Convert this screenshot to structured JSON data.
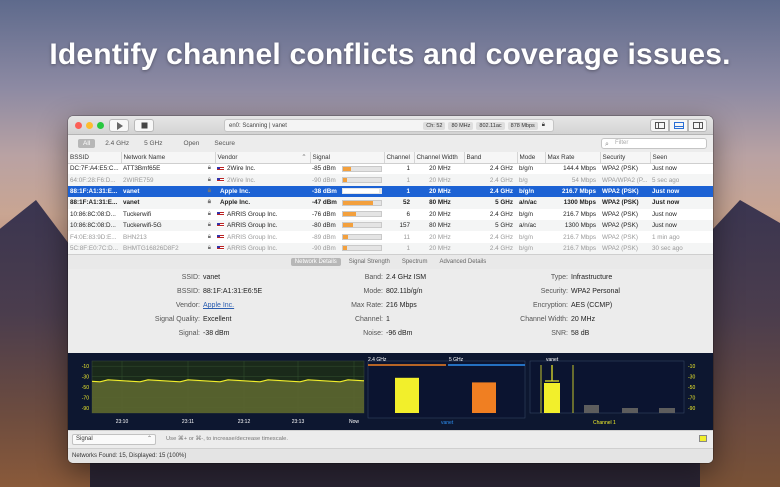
{
  "headline": "Identify channel conflicts and coverage issues.",
  "toolbar": {
    "status": "en0: Scanning  |  vanet",
    "chips": [
      "Ch: 52",
      "80 MHz",
      "802.11ac",
      "878 Mbps"
    ]
  },
  "filters": {
    "tabs": [
      "All",
      "2.4 GHz",
      "5 GHz",
      "Open",
      "Secure"
    ],
    "search_placeholder": "Filter"
  },
  "table": {
    "columns": [
      "BSSID",
      "Network Name",
      "Vendor",
      "Signal",
      "Channel",
      "Channel Width",
      "Band",
      "Mode",
      "Max Rate",
      "Security",
      "Seen"
    ],
    "rows": [
      {
        "bssid": "DC:7F:A4:E5:C...",
        "name": "ATT3Bmf65E",
        "vendor": "2Wire Inc.",
        "signal": "-85 dBm",
        "level": 0.22,
        "channel": "1",
        "width": "20 MHz",
        "band": "2.4 GHz",
        "mode": "b/g/n",
        "rate": "144.4 Mbps",
        "security": "WPA2 (PSK)",
        "seen": "Just now"
      },
      {
        "bssid": "64:0F:28:F6:D...",
        "name": "2WIRE759",
        "vendor": "2Wire Inc.",
        "signal": "-90 dBm",
        "level": 0.1,
        "channel": "1",
        "width": "20 MHz",
        "band": "2.4 GHz",
        "mode": "b/g",
        "rate": "54 Mbps",
        "security": "WPA/WPA2 (P...",
        "seen": "5 sec ago"
      },
      {
        "bssid": "88:1F:A1:31:E...",
        "name": "vanet",
        "vendor": "Apple Inc.",
        "signal": "-38 dBm",
        "level": 0.95,
        "channel": "1",
        "width": "20 MHz",
        "band": "2.4 GHz",
        "mode": "b/g/n",
        "rate": "216.7 Mbps",
        "security": "WPA2 (PSK)",
        "seen": "Just now"
      },
      {
        "bssid": "88:1F:A1:31:E...",
        "name": "vanet",
        "vendor": "Apple Inc.",
        "signal": "-47 dBm",
        "level": 0.8,
        "channel": "52",
        "width": "80 MHz",
        "band": "5 GHz",
        "mode": "a/n/ac",
        "rate": "1300 Mbps",
        "security": "WPA2 (PSK)",
        "seen": "Just now"
      },
      {
        "bssid": "10:86:8C:08:D...",
        "name": "Tuckerwifi",
        "vendor": "ARRIS Group Inc.",
        "signal": "-76 dBm",
        "level": 0.33,
        "channel": "6",
        "width": "20 MHz",
        "band": "2.4 GHz",
        "mode": "b/g/n",
        "rate": "216.7 Mbps",
        "security": "WPA2 (PSK)",
        "seen": "Just now"
      },
      {
        "bssid": "10:86:8C:08:D...",
        "name": "Tuckerwifi-5G",
        "vendor": "ARRIS Group Inc.",
        "signal": "-80 dBm",
        "level": 0.27,
        "channel": "157",
        "width": "80 MHz",
        "band": "5 GHz",
        "mode": "a/n/ac",
        "rate": "1300 Mbps",
        "security": "WPA2 (PSK)",
        "seen": "Just now"
      },
      {
        "bssid": "F4:0E:83:9D:E...",
        "name": "BHN213",
        "vendor": "ARRIS Group Inc.",
        "signal": "-89 dBm",
        "level": 0.12,
        "channel": "11",
        "width": "20 MHz",
        "band": "2.4 GHz",
        "mode": "b/g/n",
        "rate": "216.7 Mbps",
        "security": "WPA2 (PSK)",
        "seen": "1 min ago"
      },
      {
        "bssid": "5C:8F:E0:7C:D...",
        "name": "BHMTG16826D8F2",
        "vendor": "ARRIS Group Inc.",
        "signal": "-90 dBm",
        "level": 0.1,
        "channel": "1",
        "width": "20 MHz",
        "band": "2.4 GHz",
        "mode": "b/g/n",
        "rate": "216.7 Mbps",
        "security": "WPA2 (PSK)",
        "seen": "30 sec ago"
      }
    ]
  },
  "detail_tabs": [
    "Network Details",
    "Signal Strength",
    "Spectrum",
    "Advanced Details"
  ],
  "details": {
    "ssid_label": "SSID:",
    "ssid": "vanet",
    "bssid_label": "BSSID:",
    "bssid": "88:1F:A1:31:E6:5E",
    "vendor_label": "Vendor:",
    "vendor": "Apple Inc.",
    "quality_label": "Signal Quality:",
    "quality": "Excellent",
    "signal_label": "Signal:",
    "signal": "-38 dBm",
    "band_label": "Band:",
    "band": "2.4 GHz ISM",
    "mode_label": "Mode:",
    "mode": "802.11b/g/n",
    "maxrate_label": "Max Rate:",
    "maxrate": "216 Mbps",
    "channel_label": "Channel:",
    "channel": "1",
    "noise_label": "Noise:",
    "noise": "-96 dBm",
    "type_label": "Type:",
    "type": "Infrastructure",
    "security_label": "Security:",
    "security": "WPA2 Personal",
    "encryption_label": "Encryption:",
    "encryption": "AES (CCMP)",
    "chwidth_label": "Channel Width:",
    "chwidth": "20 MHz",
    "snr_label": "SNR:",
    "snr": "58 dB"
  },
  "graphs": {
    "history": {
      "y_ticks": [
        "-10",
        "-30",
        "-50",
        "-70",
        "-90"
      ],
      "x_ticks": [
        "23:10",
        "23:11",
        "23:12",
        "23:13",
        "Now"
      ],
      "signal_level": -38
    },
    "band": {
      "labels": [
        "2.4 GHz",
        "5 GHz"
      ],
      "bars": [
        {
          "label": "vanet",
          "level": -38,
          "color": "#f2ef2b"
        },
        {
          "label": "",
          "level": -47,
          "color": "#f07f22"
        }
      ]
    },
    "channel": {
      "label": "vanet",
      "x_label": "Channel 1",
      "y_ticks": [
        "-10",
        "-30",
        "-50",
        "-70",
        "-90"
      ]
    }
  },
  "bottom": {
    "select_value": "Signal",
    "hint": "Use ⌘+ or ⌘-, to increase/decrease timescale."
  },
  "status": "Networks Found: 15, Displayed: 15 (100%)"
}
